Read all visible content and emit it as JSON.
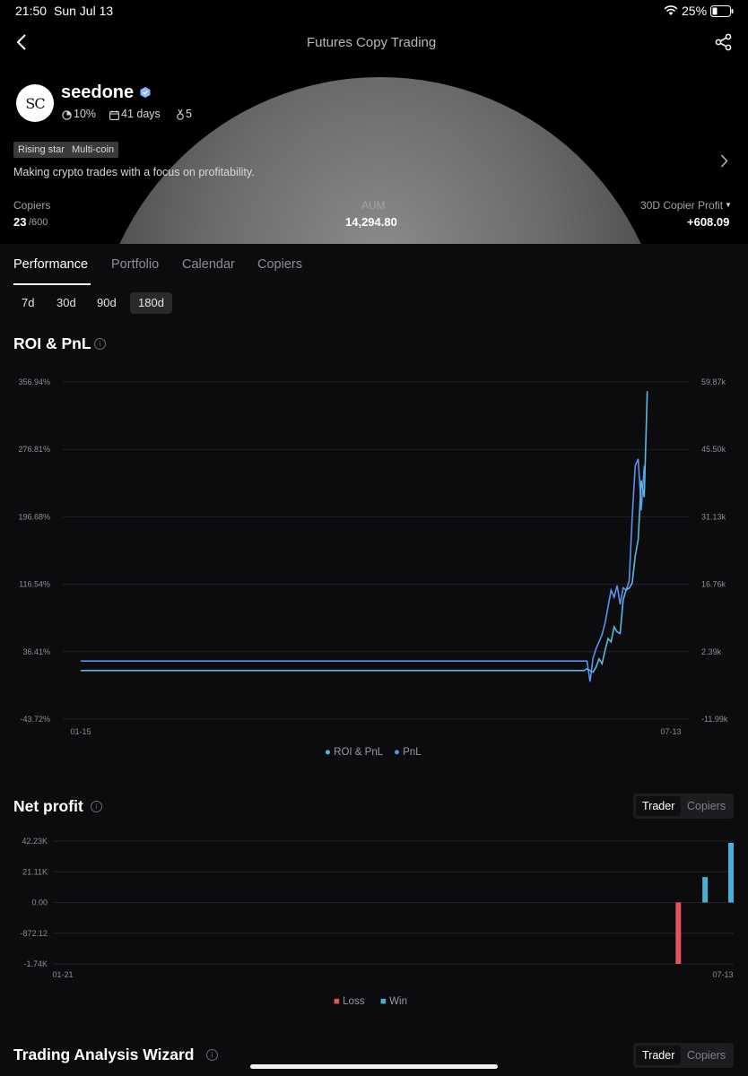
{
  "status_bar": {
    "time": "21:50",
    "date": "Sun Jul 13",
    "battery": "25%"
  },
  "nav": {
    "title": "Futures Copy Trading"
  },
  "profile": {
    "avatar_text": "SC",
    "name": "seedone",
    "roi_share": "10%",
    "days": "41 days",
    "rank": "5",
    "tags": [
      "Rising star",
      "Multi-coin"
    ],
    "description": "Making crypto trades with a focus on profitability."
  },
  "stats": {
    "copiers_label": "Copiers",
    "copiers_value": "23",
    "copiers_max": "/600",
    "aum_label": "AUM",
    "aum_value": "14,294.80",
    "profit_label": "30D Copier Profit",
    "profit_value": "+608.09"
  },
  "tabs": [
    "Performance",
    "Portfolio",
    "Calendar",
    "Copiers"
  ],
  "ranges": [
    "7d",
    "30d",
    "90d",
    "180d"
  ],
  "selected_range": "180d",
  "roi_section": {
    "title": "ROI & PnL",
    "legend": [
      "ROI & PnL",
      "PnL"
    ]
  },
  "net_section": {
    "title": "Net profit",
    "toggle": [
      "Trader",
      "Copiers"
    ],
    "legend": [
      "Loss",
      "Win"
    ]
  },
  "wizard_section": {
    "title": "Trading Analysis Wizard",
    "toggle": [
      "Trader",
      "Copiers"
    ]
  },
  "colors": {
    "roi_line": "#5bb6e0",
    "pnl_line": "#5b8ff0",
    "loss": "#e5535f",
    "win": "#4aaed6"
  },
  "chart_data": [
    {
      "type": "line",
      "title": "ROI & PnL",
      "x_start": "01-15",
      "x_end": "07-13",
      "y_left_ticks": [
        "356.94%",
        "276.81%",
        "196.68%",
        "116.54%",
        "36.41%",
        "-43.72%"
      ],
      "y_right_ticks": [
        "59.87k",
        "45.50k",
        "31.13k",
        "16.76k",
        "2.39k",
        "-11.99k"
      ],
      "ylim_left": [
        -43.72,
        356.94
      ],
      "series": [
        {
          "name": "ROI & PnL",
          "unit": "%",
          "x": [
            0,
            0.83,
            0.835,
            0.84,
            0.845,
            0.85,
            0.855,
            0.86,
            0.865,
            0.87,
            0.875,
            0.88,
            0.885,
            0.89,
            0.895,
            0.9,
            0.905,
            0.91,
            0.915,
            0.92,
            0.925,
            0.93,
            0.935,
            0.94
          ],
          "values": [
            14,
            14,
            14,
            16,
            14,
            12,
            18,
            28,
            22,
            38,
            52,
            48,
            66,
            60,
            58,
            98,
            110,
            112,
            118,
            150,
            170,
            240,
            220,
            346
          ]
        },
        {
          "name": "PnL",
          "unit": "k",
          "x": [
            0,
            0.84,
            0.845,
            0.85,
            0.855,
            0.86,
            0.865,
            0.87,
            0.875,
            0.88,
            0.885,
            0.89,
            0.895,
            0.9,
            0.905,
            0.91,
            0.915,
            0.92,
            0.925,
            0.93,
            0.935
          ],
          "values": [
            0.4,
            0.4,
            -4.0,
            1.0,
            3.0,
            4.5,
            6.0,
            8.5,
            12.0,
            15.5,
            14.0,
            16.5,
            12.5,
            16.0,
            15.5,
            17.5,
            31.0,
            42.0,
            43.5,
            32.5,
            42.0
          ]
        }
      ]
    },
    {
      "type": "bar",
      "title": "Net profit",
      "x_start": "01-21",
      "x_end": "07-13",
      "y_ticks": [
        "42.23K",
        "21.11K",
        "0.00",
        "-872.12",
        "-1.74K"
      ],
      "series": [
        {
          "name": "Loss",
          "x": [
            0.92
          ],
          "values": [
            -1.74
          ]
        },
        {
          "name": "Win",
          "x": [
            0.96,
            1.0
          ],
          "values": [
            17.5,
            41.0
          ]
        }
      ]
    }
  ]
}
